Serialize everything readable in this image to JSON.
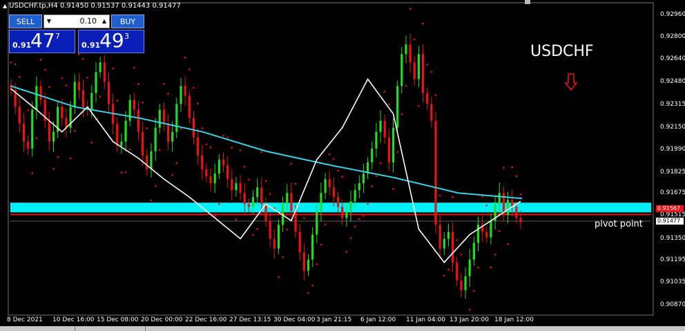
{
  "header": {
    "symbol_line": "USDCHF.tp,H4  0.91450 0.91537 0.91443 0.91477"
  },
  "trade_panel": {
    "sell_label": "SELL",
    "buy_label": "BUY",
    "lot_value": "0.10",
    "sell_price_prefix": "0.91",
    "sell_price_big": "47",
    "sell_price_sup": "7",
    "buy_price_prefix": "0.91",
    "buy_price_big": "49",
    "buy_price_sup": "3"
  },
  "annotations": {
    "title": "USDCHF",
    "pivot_label": "pivot point"
  },
  "colors": {
    "background": "#000000",
    "bull": "#22dd22",
    "bear": "#ee1111",
    "ma_slow": "#33d6e8",
    "ma_fast": "#ffffff",
    "sar": "#ee1111",
    "zone": "#00f0f8",
    "pivot_line": "#ee1111",
    "arrow": "#ee1111"
  },
  "chart_data": {
    "type": "candlestick",
    "y_range": [
      0.9081,
      0.9304
    ],
    "price_ticks": [
      "0.92960",
      "0.92800",
      "0.92640",
      "0.92480",
      "0.92315",
      "0.92150",
      "0.91990",
      "0.91825",
      "0.91675",
      "0.91515",
      "0.91350",
      "0.91195",
      "0.91035",
      "0.90870"
    ],
    "date_labels": [
      "8 Dec 2021",
      "10 Dec 16:00",
      "15 Dec 08:00",
      "20 Dec 00:00",
      "22 Dec 16:00",
      "27 Dec 13:15",
      "30 Dec 04:00",
      "3 Jan 21:15",
      "6 Jan 12:00",
      "11 Jan 04:00",
      "13 Jan 20:00",
      "18 Jan 12:00"
    ],
    "current_price": 0.91477,
    "red_tag_price": "0.91567",
    "zone": [
      0.9154,
      0.9161
    ],
    "pivot_level": 0.91525,
    "close": [
      0.9242,
      0.923,
      0.9218,
      0.9205,
      0.92,
      0.9228,
      0.9245,
      0.9235,
      0.922,
      0.9205,
      0.9212,
      0.923,
      0.9222,
      0.9215,
      0.923,
      0.9248,
      0.9242,
      0.923,
      0.9228,
      0.924,
      0.9255,
      0.9262,
      0.9248,
      0.9232,
      0.9218,
      0.9202,
      0.9205,
      0.922,
      0.9235,
      0.9228,
      0.9212,
      0.9195,
      0.9185,
      0.9198,
      0.9215,
      0.9228,
      0.9218,
      0.9205,
      0.9212,
      0.9232,
      0.9245,
      0.9238,
      0.9222,
      0.9208,
      0.9195,
      0.9185,
      0.918,
      0.9175,
      0.9182,
      0.9192,
      0.9188,
      0.9178,
      0.917,
      0.9175,
      0.9168,
      0.916,
      0.9158,
      0.9165,
      0.9172,
      0.916,
      0.9148,
      0.9135,
      0.9128,
      0.9145,
      0.916,
      0.9168,
      0.9155,
      0.914,
      0.9125,
      0.9112,
      0.912,
      0.9138,
      0.9155,
      0.9168,
      0.9178,
      0.9172,
      0.9165,
      0.9158,
      0.915,
      0.9155,
      0.9162,
      0.917,
      0.9175,
      0.9182,
      0.919,
      0.92,
      0.9212,
      0.922,
      0.9208,
      0.919,
      0.9215,
      0.9245,
      0.9268,
      0.9275,
      0.9262,
      0.925,
      0.9268,
      0.924,
      0.9232,
      0.922,
      0.9145,
      0.9128,
      0.9135,
      0.914,
      0.9118,
      0.9105,
      0.9098,
      0.9108,
      0.912,
      0.9132,
      0.9145,
      0.914,
      0.9136,
      0.9148,
      0.916,
      0.9168,
      0.9152,
      0.9163,
      0.9158,
      0.915,
      0.9147
    ],
    "ma_slow_level": [
      0.9245,
      0.923,
      0.9222,
      0.9212,
      0.9198,
      0.9188,
      0.9179,
      0.9168,
      0.9164
    ],
    "ma_fast_level": [
      0.9243,
      0.9228,
      0.9212,
      0.923,
      0.9205,
      0.9193,
      0.9178,
      0.9165,
      0.915,
      0.9135,
      0.916,
      0.9148,
      0.9192,
      0.9215,
      0.925,
      0.9225,
      0.9142,
      0.9118,
      0.9138,
      0.915,
      0.9162
    ]
  }
}
